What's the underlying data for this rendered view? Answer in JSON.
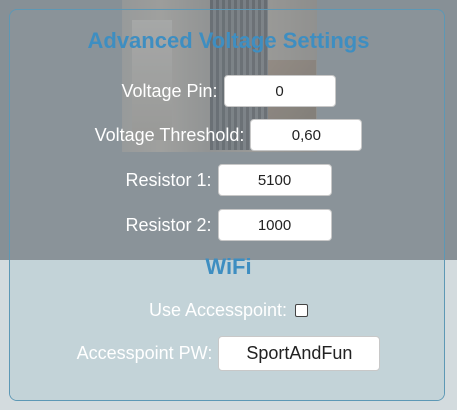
{
  "voltage": {
    "title": "Advanced Voltage Settings",
    "pin_label": "Voltage Pin:",
    "pin_value": "0",
    "threshold_label": "Voltage Threshold:",
    "threshold_value": "0,60",
    "r1_label": "Resistor 1:",
    "r1_value": "5100",
    "r2_label": "Resistor 2:",
    "r2_value": "1000"
  },
  "wifi": {
    "title": "WiFi",
    "accesspoint_label": "Use Accesspoint:",
    "accesspoint_checked": false,
    "pw_label": "Accesspoint PW:",
    "pw_value": "SportAndFun"
  },
  "colors": {
    "title": "#3e8ec1",
    "panel_border": "#5d98b5"
  }
}
